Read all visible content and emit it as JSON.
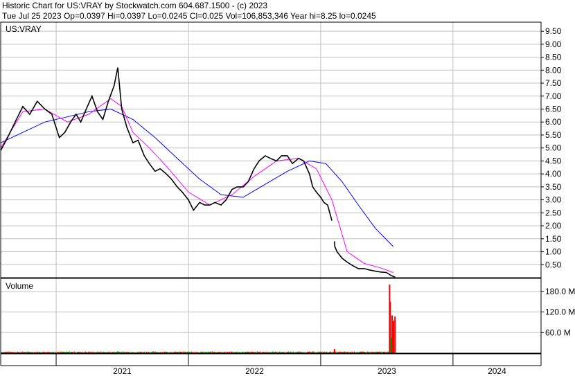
{
  "header": {
    "line1": "Historic Chart for US:VRAY by Stockwatch.com 604.687.1500 - (c) 2023",
    "line2": "Tue Jul 25 2023   Op=0.0397   Hi=0.0397   Lo=0.0245   Cl=0.025   Vol=106,853,346   Year hi=8.25   lo=0.0245"
  },
  "price_panel_label": "US:VRAY",
  "volume_panel_label": "Volume",
  "colors": {
    "price": "#000000",
    "ma_short": "#ff00ff",
    "ma_long": "#0000ff",
    "volume_up": "#00a000",
    "volume_down": "#ff0000",
    "grid": "#c0c0c0",
    "frame": "#000000"
  },
  "chart_data": [
    {
      "type": "line",
      "panel": "price",
      "x_labels": [
        "2021",
        "2022",
        "2023",
        "2024"
      ],
      "y_ticks": [
        "9.50",
        "9.00",
        "8.50",
        "8.00",
        "7.50",
        "7.00",
        "6.50",
        "6.00",
        "5.50",
        "5.00",
        "4.50",
        "4.00",
        "3.50",
        "3.00",
        "2.50",
        "2.00",
        "1.50",
        "1.00",
        "0.50"
      ],
      "y_axis_side": "right",
      "ylim": [
        0,
        9.85
      ],
      "x_range": [
        "2020-08-01",
        "2024-08-31"
      ],
      "grid": true,
      "series": [
        {
          "role": "price",
          "x": [
            "2020-08-01",
            "2020-08-20",
            "2020-09-10",
            "2020-10-01",
            "2020-10-20",
            "2020-11-10",
            "2020-12-01",
            "2020-12-20",
            "2021-01-10",
            "2021-01-25",
            "2021-02-10",
            "2021-02-25",
            "2021-03-10",
            "2021-03-25",
            "2021-04-10",
            "2021-04-25",
            "2021-05-10",
            "2021-05-25",
            "2021-06-10",
            "2021-06-20",
            "2021-07-01",
            "2021-07-15",
            "2021-08-01",
            "2021-08-15",
            "2021-09-01",
            "2021-09-15",
            "2021-10-01",
            "2021-10-15",
            "2021-11-01",
            "2021-11-15",
            "2021-12-01",
            "2021-12-15",
            "2022-01-01",
            "2022-01-15",
            "2022-02-01",
            "2022-02-15",
            "2022-03-01",
            "2022-03-15",
            "2022-04-01",
            "2022-04-15",
            "2022-05-01",
            "2022-05-15",
            "2022-06-01",
            "2022-06-15",
            "2022-07-01",
            "2022-07-15",
            "2022-08-01",
            "2022-08-15",
            "2022-09-01",
            "2022-09-15",
            "2022-10-01",
            "2022-10-15",
            "2022-11-01",
            "2022-11-15",
            "2022-12-01",
            "2022-12-10",
            "2022-12-20",
            "2023-01-01",
            "2023-01-10",
            "2023-01-20",
            "2023-02-01",
            "2023-02-08",
            "2023-02-09",
            "2023-02-15",
            "2023-03-01",
            "2023-03-15",
            "2023-04-01",
            "2023-04-15",
            "2023-05-01",
            "2023-05-15",
            "2023-06-01",
            "2023-06-15",
            "2023-07-01",
            "2023-07-15",
            "2023-07-25"
          ],
          "values": [
            4.9,
            5.4,
            6.0,
            6.6,
            6.3,
            6.8,
            6.5,
            6.3,
            5.4,
            5.6,
            6.0,
            6.3,
            6.0,
            6.5,
            7.0,
            6.4,
            6.1,
            6.8,
            7.4,
            8.1,
            6.5,
            5.8,
            5.2,
            5.3,
            4.7,
            4.4,
            4.1,
            4.2,
            4.0,
            3.8,
            3.5,
            3.3,
            3.0,
            2.6,
            2.9,
            2.8,
            2.8,
            2.9,
            2.8,
            3.0,
            3.4,
            3.5,
            3.5,
            3.7,
            4.2,
            4.5,
            4.7,
            4.6,
            4.5,
            4.7,
            4.7,
            4.4,
            4.6,
            4.5,
            4.0,
            3.5,
            3.3,
            3.1,
            2.9,
            2.8,
            2.2,
            1.4,
            1.2,
            1.0,
            0.75,
            0.6,
            0.45,
            0.35,
            0.35,
            0.3,
            0.25,
            0.22,
            0.2,
            0.08,
            0.025
          ]
        },
        {
          "role": "ma_short",
          "x": [
            "2020-08-01",
            "2020-10-01",
            "2020-12-01",
            "2021-02-01",
            "2021-04-01",
            "2021-06-01",
            "2021-07-01",
            "2021-08-01",
            "2021-09-15",
            "2021-11-01",
            "2022-01-01",
            "2022-03-01",
            "2022-05-01",
            "2022-07-01",
            "2022-09-01",
            "2022-11-01",
            "2022-12-20",
            "2023-02-01",
            "2023-03-15",
            "2023-05-01",
            "2023-06-15",
            "2023-07-20"
          ],
          "values": [
            5.0,
            6.4,
            6.5,
            6.0,
            6.3,
            6.9,
            6.6,
            5.6,
            5.0,
            4.3,
            3.3,
            2.8,
            3.2,
            3.9,
            4.5,
            4.6,
            4.2,
            3.0,
            1.0,
            0.55,
            0.38,
            0.2
          ]
        },
        {
          "role": "ma_long",
          "x": [
            "2020-08-01",
            "2020-10-01",
            "2020-12-01",
            "2021-02-01",
            "2021-04-01",
            "2021-06-01",
            "2021-08-01",
            "2021-10-01",
            "2021-12-01",
            "2022-02-01",
            "2022-04-01",
            "2022-06-01",
            "2022-08-01",
            "2022-10-01",
            "2022-12-01",
            "2023-01-15",
            "2023-03-01",
            "2023-04-15",
            "2023-06-01",
            "2023-07-20"
          ],
          "values": [
            5.2,
            5.6,
            6.0,
            6.2,
            6.4,
            6.5,
            6.1,
            5.4,
            4.6,
            3.8,
            3.2,
            3.1,
            3.6,
            4.1,
            4.5,
            4.4,
            3.7,
            2.8,
            1.9,
            1.2
          ]
        }
      ]
    },
    {
      "type": "bar",
      "panel": "volume",
      "y_ticks": [
        "180.0 M",
        "120.0 M",
        "60.0 M"
      ],
      "ylim": [
        0,
        210
      ],
      "grid": true,
      "series": [
        {
          "role": "volume",
          "x": [
            "2020-09-01",
            "2020-12-01",
            "2021-03-01",
            "2021-05-01",
            "2021-06-20",
            "2021-09-01",
            "2021-12-01",
            "2022-03-01",
            "2022-06-01",
            "2022-09-01",
            "2022-11-01",
            "2022-12-01",
            "2023-02-08",
            "2023-03-01",
            "2023-05-01",
            "2023-06-10",
            "2023-07-01",
            "2023-07-10",
            "2023-07-12",
            "2023-07-14",
            "2023-07-17",
            "2023-07-19",
            "2023-07-21",
            "2023-07-25"
          ],
          "values": [
            2,
            3,
            3,
            3,
            5,
            2,
            3,
            2,
            2,
            2,
            3,
            3,
            12,
            2,
            2,
            3,
            3,
            200,
            150,
            45,
            110,
            75,
            95,
            107
          ],
          "direction": [
            "down",
            "down",
            "up",
            "down",
            "up",
            "down",
            "down",
            "down",
            "up",
            "up",
            "down",
            "down",
            "down",
            "down",
            "down",
            "down",
            "down",
            "down",
            "down",
            "up",
            "down",
            "down",
            "down",
            "down"
          ]
        }
      ]
    }
  ]
}
